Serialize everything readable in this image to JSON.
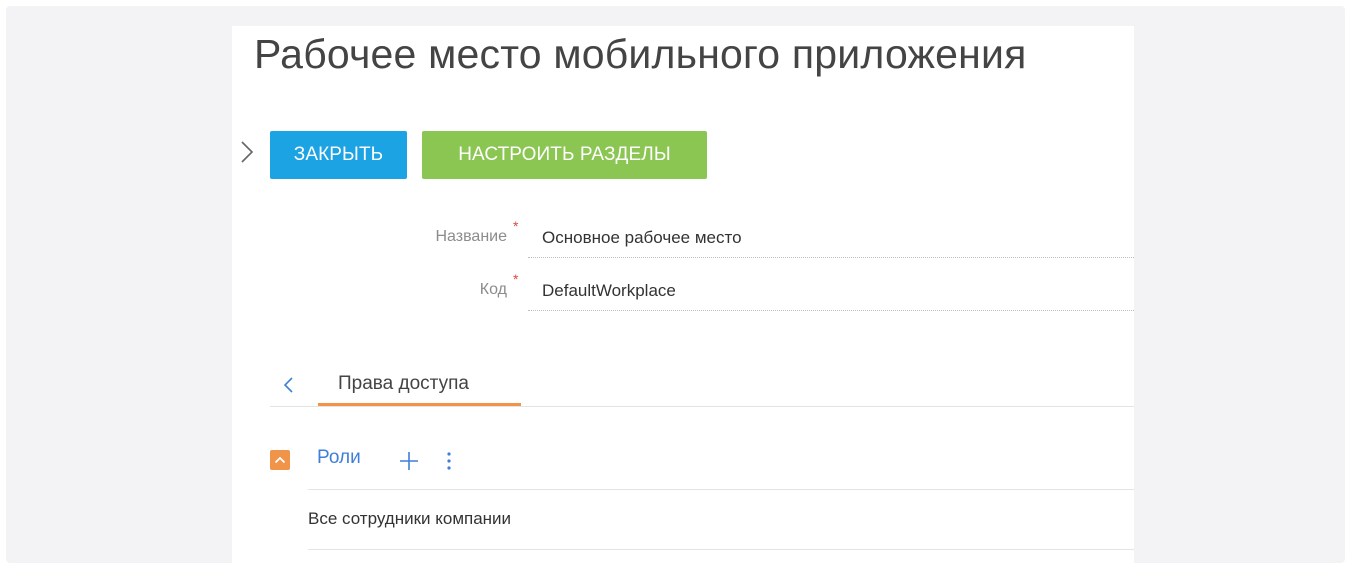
{
  "page": {
    "title": "Рабочее место мобильного приложения"
  },
  "toolbar": {
    "close_label": "ЗАКРЫТЬ",
    "setup_sections_label": "НАСТРОИТЬ РАЗДЕЛЫ",
    "expand_icon": "chevron-right-icon"
  },
  "colors": {
    "close_button": "#1ba3e3",
    "setup_button": "#8bc653",
    "accent_orange": "#f0944a",
    "link_blue": "#3f7fd9",
    "required_red": "#e0483b"
  },
  "form": {
    "name": {
      "label": "Название",
      "required_mark": "*",
      "value": "Основное рабочее место"
    },
    "code": {
      "label": "Код",
      "required_mark": "*",
      "value": "DefaultWorkplace"
    }
  },
  "tabs": {
    "prev_icon": "chevron-left-icon",
    "items": [
      {
        "label": "Права доступа",
        "active": true
      }
    ]
  },
  "roles_group": {
    "title": "Роли",
    "collapse_icon": "chevron-up-icon",
    "add_icon": "plus-icon",
    "menu_icon": "more-vertical-icon",
    "items": [
      {
        "label": "Все сотрудники компании"
      }
    ]
  }
}
